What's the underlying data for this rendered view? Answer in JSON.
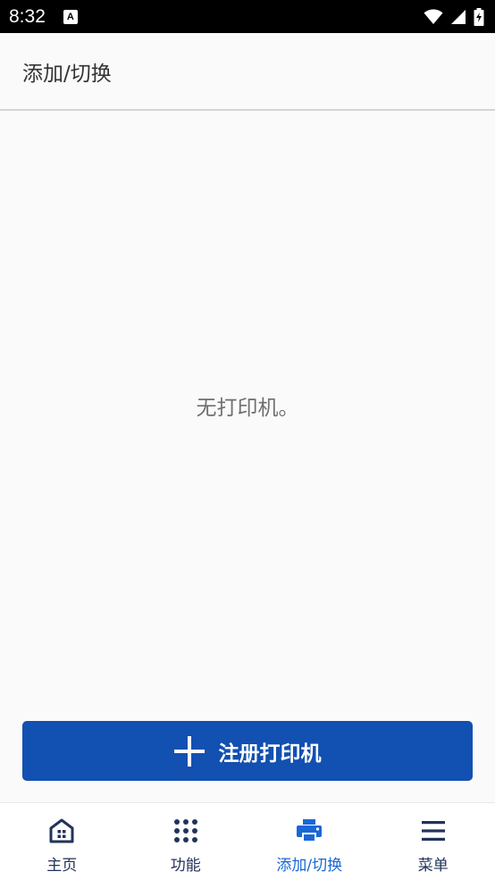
{
  "status_bar": {
    "time": "8:32",
    "notification_icon": "a-icon",
    "icons": [
      "wifi-icon",
      "signal-icon",
      "battery-icon"
    ]
  },
  "header": {
    "title": "添加/切换"
  },
  "main": {
    "empty_message": "无打印机。",
    "register_button_label": "注册打印机"
  },
  "bottom_nav": {
    "items": [
      {
        "label": "主页",
        "icon": "home-icon",
        "active": false
      },
      {
        "label": "功能",
        "icon": "grid-icon",
        "active": false
      },
      {
        "label": "添加/切换",
        "icon": "printer-icon",
        "active": true
      },
      {
        "label": "菜单",
        "icon": "menu-icon",
        "active": false
      }
    ]
  },
  "colors": {
    "primary": "#1250b1",
    "nav_active": "#1a67d6",
    "nav_inactive": "#22335a",
    "background": "#fafafa"
  }
}
